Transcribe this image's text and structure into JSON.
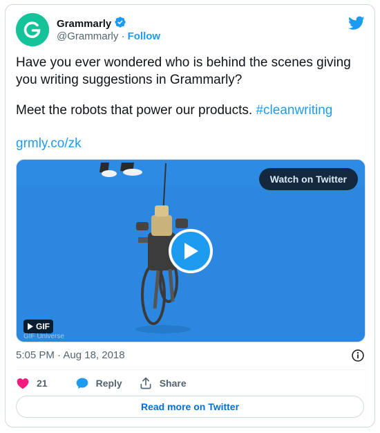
{
  "tweet": {
    "author": {
      "name": "Grammarly",
      "handle": "@Grammarly",
      "follow_label": "Follow",
      "avatar_letter": "G",
      "verified": true
    },
    "text_line1": "Have you ever wondered who is behind the scenes giving you writing suggestions in Grammarly?",
    "text_line2": "Meet the robots that power our products.",
    "hashtag": "#cleanwriting",
    "link": "grmly.co/zk",
    "media": {
      "watch_label": "Watch on Twitter",
      "badge_label": "GIF",
      "watermark": "GIF Universe"
    },
    "timestamp": "5:05 PM · Aug 18, 2018",
    "likes": "21",
    "reply_label": "Reply",
    "share_label": "Share",
    "read_more_label": "Read more on Twitter"
  },
  "colors": {
    "accent": "#1d9bf0",
    "like": "#f91880",
    "brand": "#15c39a",
    "media_bg": "#2a86de"
  },
  "icons": [
    "grammarly-logo-icon",
    "verified-badge-icon",
    "twitter-bird-icon",
    "play-icon",
    "info-icon",
    "heart-icon",
    "reply-icon",
    "share-icon"
  ]
}
